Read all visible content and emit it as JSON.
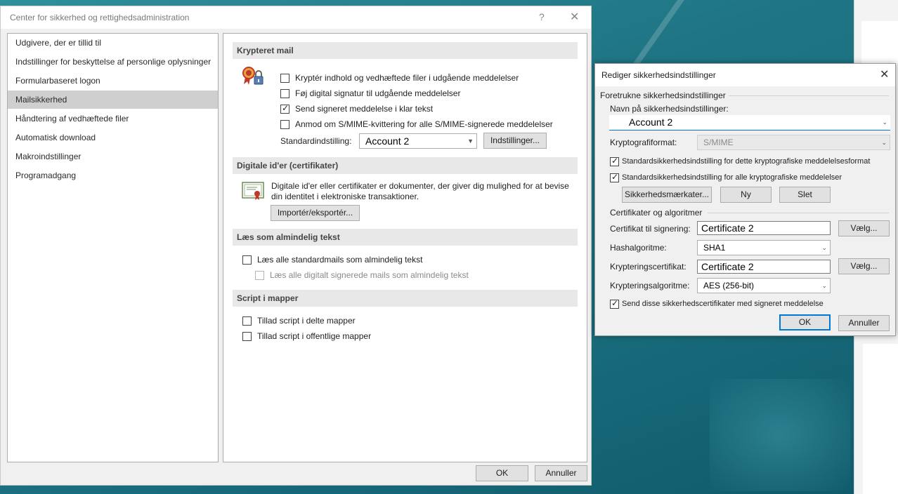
{
  "main_dialog": {
    "title": "Center for sikkerhed og rettighedsadministration",
    "help_glyph": "?",
    "close_glyph": "✕",
    "nav_items": [
      "Udgivere, der er tillid til",
      "Indstillinger for beskyttelse af personlige oplysninger",
      "Formularbaseret logon",
      "Mailsikkerhed",
      "Håndtering af vedhæftede filer",
      "Automatisk download",
      "Makroindstillinger",
      "Programadgang"
    ],
    "selected_nav": "Mailsikkerhed",
    "encrypted_mail": {
      "heading": "Krypteret mail",
      "options": [
        {
          "label": "Kryptér indhold og vedhæftede filer i udgående meddelelser",
          "checked": false
        },
        {
          "label": "Føj digital signatur til udgående meddelelser",
          "checked": false
        },
        {
          "label": "Send signeret meddelelse i klar tekst",
          "checked": true
        },
        {
          "label": "Anmod om S/MIME-kvittering for alle S/MIME-signerede meddelelser",
          "checked": false
        }
      ],
      "default_setting_label": "Standardindstilling:",
      "default_setting_value": "Account 2",
      "settings_button": "Indstillinger..."
    },
    "digital_ids": {
      "heading": "Digitale id'er (certifikater)",
      "description": "Digitale id'er eller certifikater er dokumenter, der giver dig mulighed for at bevise din identitet i elektroniske transaktioner.",
      "import_export_button": "Importér/eksportér..."
    },
    "plain_text": {
      "heading": "Læs som almindelig tekst",
      "options": [
        {
          "label": "Læs alle standardmails som almindelig tekst",
          "checked": false,
          "disabled": false
        },
        {
          "label": "Læs alle digitalt signerede mails som almindelig tekst",
          "checked": false,
          "disabled": true
        }
      ]
    },
    "script_folders": {
      "heading": "Script i mapper",
      "options": [
        {
          "label": "Tillad script i delte mapper",
          "checked": false
        },
        {
          "label": "Tillad script i offentlige mapper",
          "checked": false
        }
      ]
    },
    "ok_button": "OK",
    "cancel_button": "Annuller"
  },
  "security_dialog": {
    "title": "Rediger sikkerhedsindstillinger",
    "close_glyph": "✕",
    "group_preferred": "Foretrukne sikkerhedsindstillinger",
    "name_label": "Navn på sikkerhedsindstillinger:",
    "name_value": "Account 2",
    "crypto_format_label": "Kryptografiformat:",
    "crypto_format_value": "S/MIME",
    "default_for_format": {
      "label": "Standardsikkerhedsindstilling for dette kryptografiske meddelelsesformat",
      "checked": true
    },
    "default_for_all": {
      "label": "Standardsikkerhedsindstilling for alle kryptografiske meddelelser",
      "checked": true
    },
    "security_labels_button": "Sikkerhedsmærkater...",
    "new_button": "Ny",
    "delete_button": "Slet",
    "group_certs": "Certifikater og algoritmer",
    "signing_cert_label": "Certifikat til signering:",
    "signing_cert_value": "Certificate 2",
    "hash_label": "Hashalgoritme:",
    "hash_value": "SHA1",
    "enc_cert_label": "Krypteringscertifikat:",
    "enc_cert_value": "Certificate 2",
    "enc_alg_label": "Krypteringsalgoritme:",
    "enc_alg_value": "AES (256-bit)",
    "choose_button": "Vælg...",
    "send_certs": {
      "label": "Send disse sikkerhedscertifikater med signeret meddelelse",
      "checked": true
    },
    "ok_button": "OK",
    "cancel_button": "Annuller"
  },
  "colors": {
    "accent": "#0078d7",
    "selected_nav": "#cfcfcf",
    "section_header": "#e8e8e8"
  }
}
